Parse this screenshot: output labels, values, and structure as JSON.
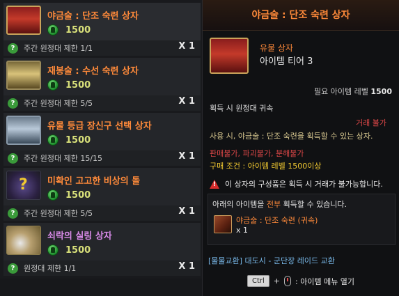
{
  "list": {
    "items": [
      {
        "name": "야금술 : 단조 숙련 상자",
        "price": "1500",
        "limit": "주간 원정대 제한 1/1",
        "qty": "X 1",
        "thumb": "red-treasure-chest",
        "name_color": "#ff8a3a"
      },
      {
        "name": "재봉술 : 수선 숙련 상자",
        "price": "1500",
        "limit": "주간 원정대 제한 5/5",
        "qty": "X 1",
        "thumb": "gold-treasure-chest",
        "name_color": "#ff8a3a"
      },
      {
        "name": "유물 등급 장신구 선택 상자",
        "price": "1500",
        "limit": "주간 원정대 제한 15/15",
        "qty": "X 1",
        "thumb": "silver-treasure-chest",
        "name_color": "#ff8a3a"
      },
      {
        "name": "미확인 고고한 비상의 돌",
        "price": "1500",
        "limit": "주간 원정대 제한 5/5",
        "qty": "X 1",
        "thumb": "unidentified-stone",
        "name_color": "#ff8a3a"
      },
      {
        "name": "쇠락의 실링 상자",
        "price": "1500",
        "limit": "원정대 제한 1/1",
        "qty": "X 1",
        "thumb": "silling-coins",
        "name_color": "#d88ae8"
      }
    ]
  },
  "tooltip": {
    "title": "야금술 : 단조 숙련 상자",
    "grade": "유물 상자",
    "tier": "아이템 티어 3",
    "req_label": "필요 아이템 레벨",
    "req_value": "1500",
    "bind": "획득 시 원정대 귀속",
    "untradeable": "거래 불가",
    "use_text": "사용 시, 야금술 : 단조 숙련을 획득할 수 있는 상자.",
    "sale": "판매불가, 파괴불가, 분해불가",
    "buy_condition": "구매 조건 : 아이템 레벨 1500이상",
    "warning": "이 상자의 구성품은 획득 시 거래가 불가능합니다.",
    "box": {
      "title_pre": "아래의 아이템을 ",
      "title_hl": "전부",
      "title_post": " 획득할 수 있습니다.",
      "item_name": "야금술 : 단조 숙련 (귀속)",
      "item_qty": "x 1"
    },
    "exchange": "[물물교환] 대도시 - 군단장 레이드 교환",
    "hint_key": "Ctrl",
    "hint_plus": "+",
    "hint_text": ": 아이템 메뉴 열기"
  },
  "colors": {
    "accent_orange": "#ff8a3a",
    "epic_purple": "#d88ae8",
    "price_yellow": "#d8e07a",
    "warn_red": "#e04848",
    "link_blue": "#78b8e8"
  },
  "icons": [
    "coin-icon",
    "question-icon",
    "warning-icon",
    "mouse-icon"
  ]
}
